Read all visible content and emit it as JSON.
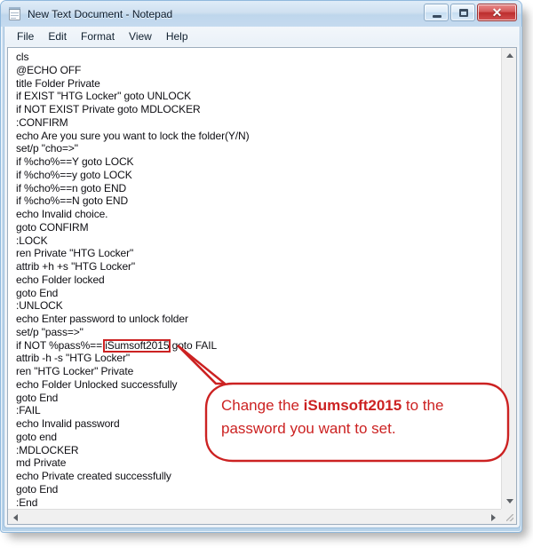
{
  "window": {
    "title": "New Text Document - Notepad",
    "icon": "notepad-icon",
    "controls": {
      "minimize": "–",
      "maximize": "□",
      "close": "✕"
    }
  },
  "menu": {
    "items": [
      {
        "label": "File"
      },
      {
        "label": "Edit"
      },
      {
        "label": "Format"
      },
      {
        "label": "View"
      },
      {
        "label": "Help"
      }
    ]
  },
  "editor": {
    "lines": [
      "cls",
      "@ECHO OFF",
      "title Folder Private",
      "if EXIST \"HTG Locker\" goto UNLOCK",
      "if NOT EXIST Private goto MDLOCKER",
      ":CONFIRM",
      "echo Are you sure you want to lock the folder(Y/N)",
      "set/p \"cho=>\"",
      "if %cho%==Y goto LOCK",
      "if %cho%==y goto LOCK",
      "if %cho%==n goto END",
      "if %cho%==N goto END",
      "echo Invalid choice.",
      "goto CONFIRM",
      ":LOCK",
      "ren Private \"HTG Locker\"",
      "attrib +h +s \"HTG Locker\"",
      "echo Folder locked",
      "goto End",
      ":UNLOCK",
      "echo Enter password to unlock folder",
      "set/p \"pass=>\"",
      "if NOT %pass%== iSumsoft2015 goto FAIL",
      "attrib -h -s \"HTG Locker\"",
      "ren \"HTG Locker\" Private",
      "echo Folder Unlocked successfully",
      "goto End",
      ":FAIL",
      "echo Invalid password",
      "goto end",
      ":MDLOCKER",
      "md Private",
      "echo Private created successfully",
      "goto End",
      ":End"
    ]
  },
  "annotation": {
    "highlighted_token": "iSumsoft2015",
    "callout_line1_prefix": "Change the ",
    "callout_line1_strong": "iSumsoft2015",
    "callout_line1_suffix": " to the",
    "callout_line2": "password you want to set."
  },
  "colors": {
    "annotation_red": "#cc2222",
    "titlebar_blue": "#cfe0f0",
    "frame_border": "#8fb8dc",
    "close_button_red": "#bc2e2e"
  },
  "scrollbars": {
    "vertical_up": "scroll-up-arrow",
    "vertical_down": "scroll-down-arrow",
    "horizontal_left": "scroll-left-arrow",
    "horizontal_right": "scroll-right-arrow"
  }
}
